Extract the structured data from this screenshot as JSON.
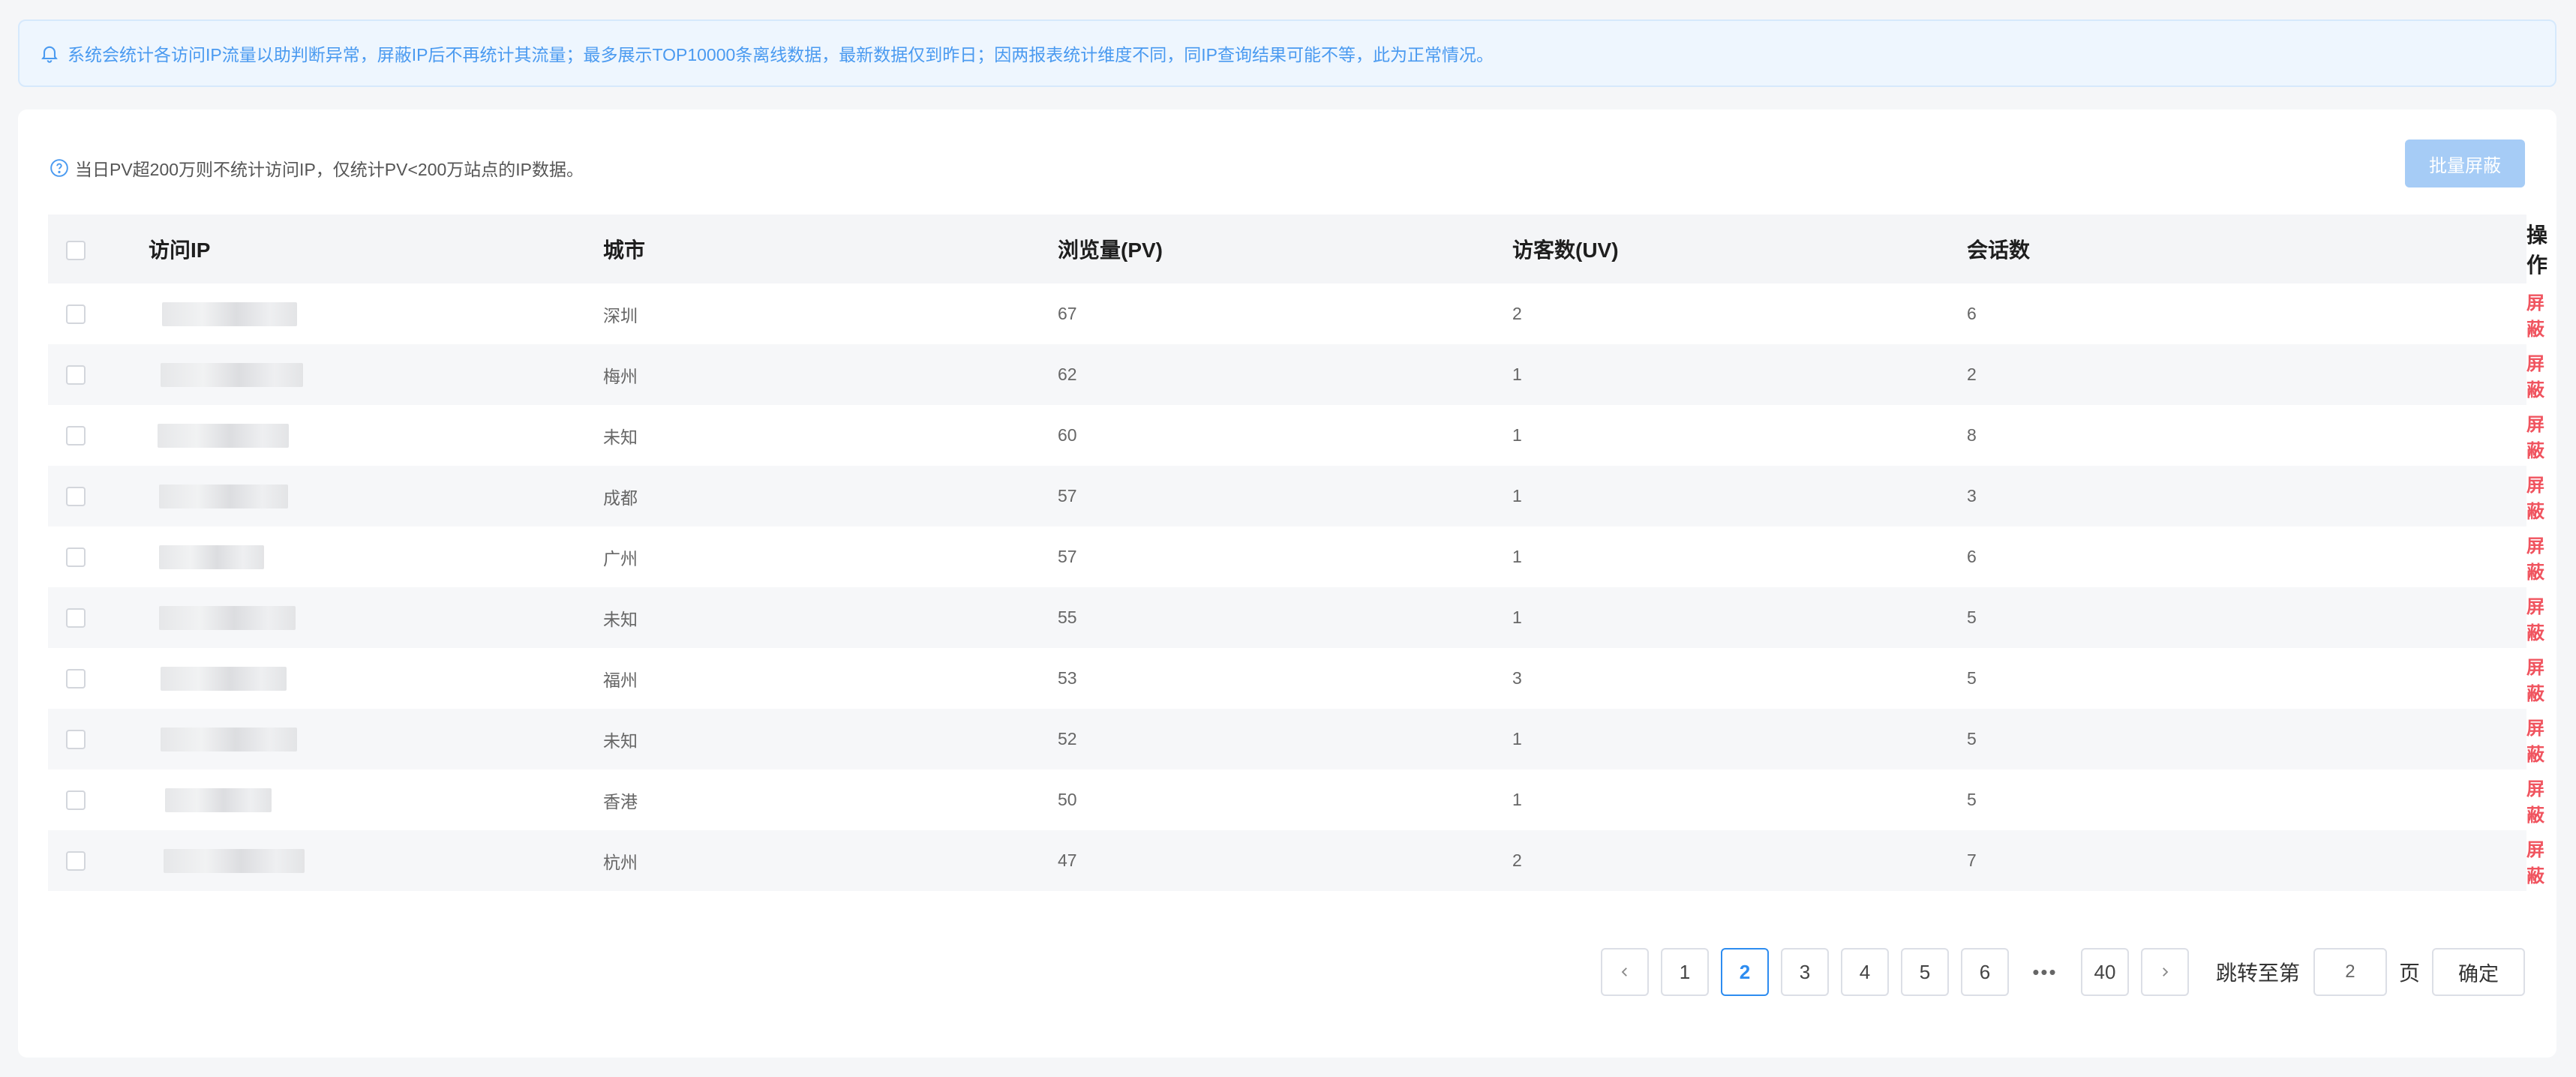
{
  "notice": {
    "icon": "bell-icon",
    "text": "系统会统计各访问IP流量以助判断异常，屏蔽IP后不再统计其流量；最多展示TOP10000条离线数据，最新数据仅到昨日；因两报表统计维度不同，同IP查询结果可能不等，此为正常情况。"
  },
  "tip": {
    "icon": "question-circle-icon",
    "text": "当日PV超200万则不统计访问IP，仅统计PV<200万站点的IP数据。"
  },
  "batch_button": "批量屏蔽",
  "table": {
    "headers": [
      "访问IP",
      "城市",
      "浏览量(PV)",
      "访客数(UV)",
      "会话数",
      "操作"
    ],
    "rows": [
      {
        "city": "深圳",
        "pv": "67",
        "uv": "2",
        "sessions": "6",
        "action": "屏蔽"
      },
      {
        "city": "梅州",
        "pv": "62",
        "uv": "1",
        "sessions": "2",
        "action": "屏蔽"
      },
      {
        "city": "未知",
        "pv": "60",
        "uv": "1",
        "sessions": "8",
        "action": "屏蔽"
      },
      {
        "city": "成都",
        "pv": "57",
        "uv": "1",
        "sessions": "3",
        "action": "屏蔽"
      },
      {
        "city": "广州",
        "pv": "57",
        "uv": "1",
        "sessions": "6",
        "action": "屏蔽"
      },
      {
        "city": "未知",
        "pv": "55",
        "uv": "1",
        "sessions": "5",
        "action": "屏蔽"
      },
      {
        "city": "福州",
        "pv": "53",
        "uv": "3",
        "sessions": "5",
        "action": "屏蔽"
      },
      {
        "city": "未知",
        "pv": "52",
        "uv": "1",
        "sessions": "5",
        "action": "屏蔽"
      },
      {
        "city": "香港",
        "pv": "50",
        "uv": "1",
        "sessions": "5",
        "action": "屏蔽"
      },
      {
        "city": "杭州",
        "pv": "47",
        "uv": "2",
        "sessions": "7",
        "action": "屏蔽"
      }
    ]
  },
  "pagination": {
    "prev_icon": "chevron-left-icon",
    "next_icon": "chevron-right-icon",
    "pages": [
      "1",
      "2",
      "3",
      "4",
      "5",
      "6"
    ],
    "current": "2",
    "ellipsis": "•••",
    "last": "40",
    "jump_label": "跳转至第",
    "jump_value": "2",
    "jump_unit": "页",
    "confirm": "确定"
  },
  "colors": {
    "accent": "#2d8cf0",
    "danger": "#f0545f",
    "notice_bg": "#eef6fe",
    "notice_text": "#4a9af0"
  }
}
